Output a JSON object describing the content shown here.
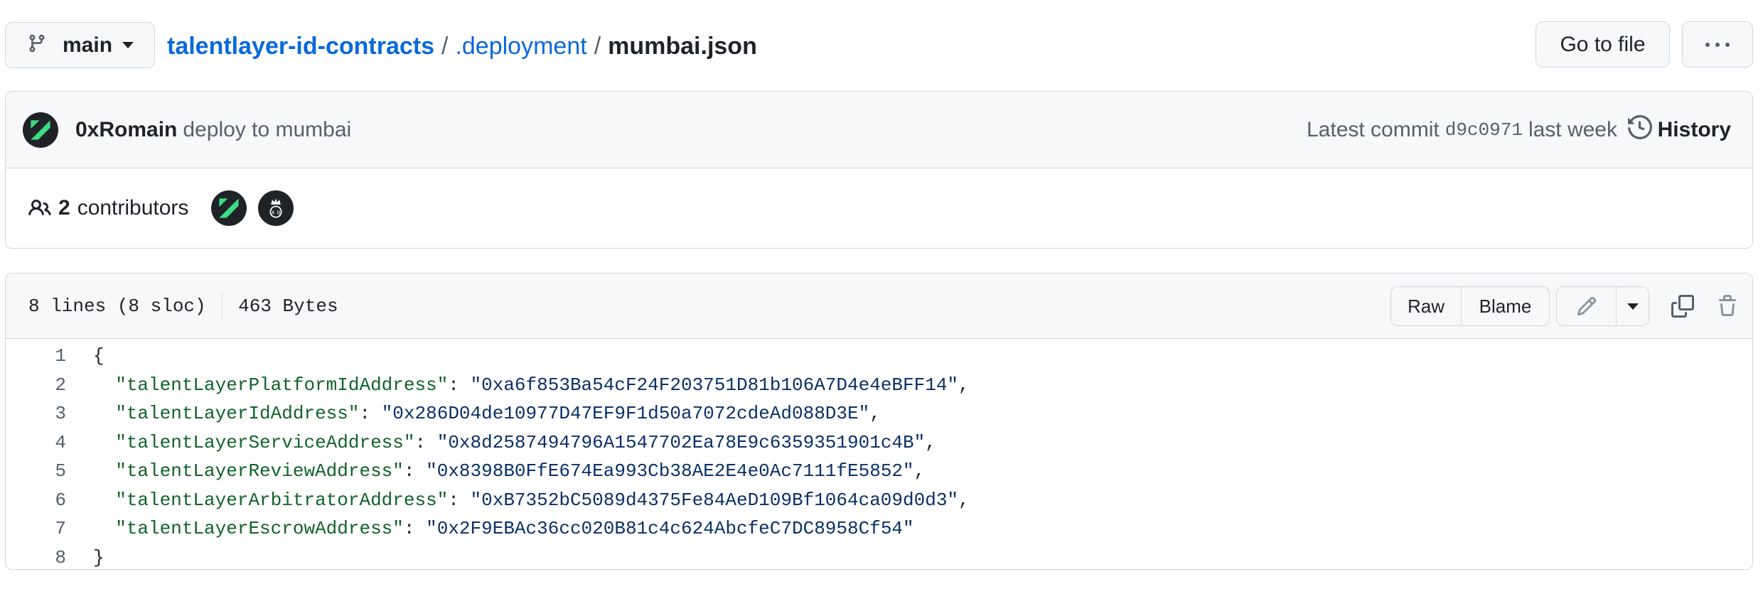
{
  "header": {
    "branch": "main",
    "breadcrumb": {
      "repo": "talentlayer-id-contracts",
      "sep1": "/",
      "folder": ".deployment",
      "sep2": "/",
      "file": "mumbai.json"
    },
    "go_to_file_label": "Go to file",
    "more_icon": "kebab-horizontal-icon"
  },
  "commit": {
    "author": "0xRomain",
    "message": "deploy to mumbai",
    "latest_label": "Latest commit",
    "sha": "d9c0971",
    "time": "last week",
    "history_label": "History"
  },
  "contributors": {
    "count": "2",
    "label": "contributors"
  },
  "file": {
    "lines_info": "8 lines (8 sloc)",
    "size": "463 Bytes",
    "raw_label": "Raw",
    "blame_label": "Blame",
    "lines": [
      {
        "num": "1",
        "open": "{"
      },
      {
        "num": "2",
        "key": "\"talentLayerPlatformIdAddress\"",
        "colon": ": ",
        "value": "\"0xa6f853Ba54cF24F203751D81b106A7D4e4eBFF14\"",
        "comma": ","
      },
      {
        "num": "3",
        "key": "\"talentLayerIdAddress\"",
        "colon": ": ",
        "value": "\"0x286D04de10977D47EF9F1d50a7072cdeAd088D3E\"",
        "comma": ","
      },
      {
        "num": "4",
        "key": "\"talentLayerServiceAddress\"",
        "colon": ": ",
        "value": "\"0x8d2587494796A1547702Ea78E9c6359351901c4B\"",
        "comma": ","
      },
      {
        "num": "5",
        "key": "\"talentLayerReviewAddress\"",
        "colon": ": ",
        "value": "\"0x8398B0FfE674Ea993Cb38AE2E4e0Ac7111fE5852\"",
        "comma": ","
      },
      {
        "num": "6",
        "key": "\"talentLayerArbitratorAddress\"",
        "colon": ": ",
        "value": "\"0xB7352bC5089d4375Fe84AeD109Bf1064ca09d0d3\"",
        "comma": ","
      },
      {
        "num": "7",
        "key": "\"talentLayerEscrowAddress\"",
        "colon": ": ",
        "value": "\"0x2F9EBAc36cc020B81c4c624AbcfeC7DC8958Cf54\"",
        "comma": ""
      },
      {
        "num": "8",
        "close": "}"
      }
    ]
  },
  "colors": {
    "link": "#0969da",
    "json_key": "#116329",
    "json_string": "#0a3069",
    "border": "#d0d7de",
    "header_bg": "#f6f8fa"
  }
}
